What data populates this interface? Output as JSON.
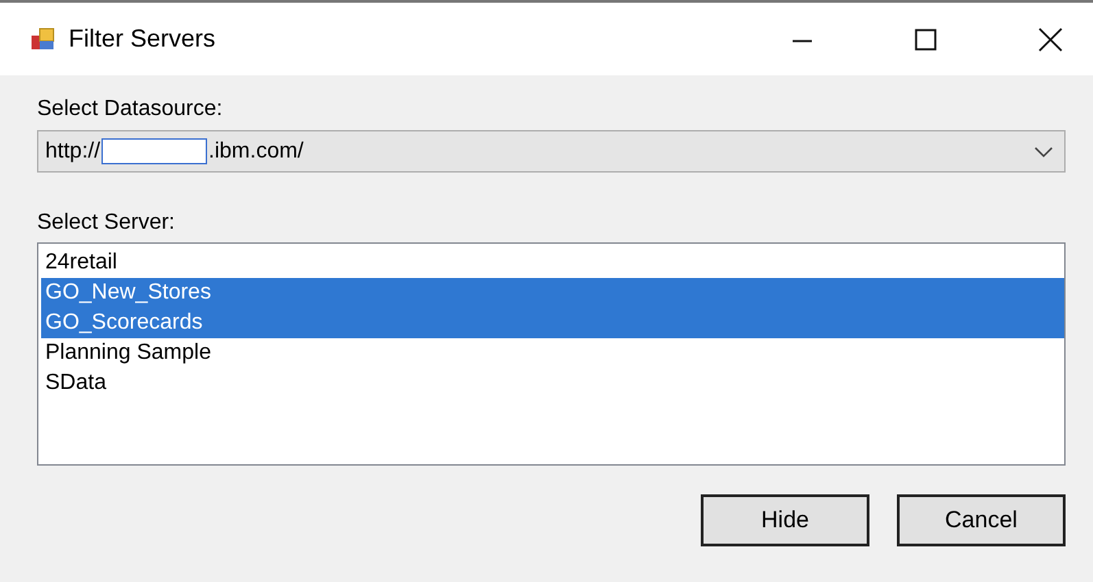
{
  "window": {
    "title": "Filter Servers"
  },
  "datasource": {
    "label": "Select Datasource:",
    "value_start": "http://",
    "value_end": ".ibm.com/",
    "redacted": true
  },
  "server_list": {
    "label": "Select Server:",
    "items": [
      {
        "label": "24retail",
        "selected": false
      },
      {
        "label": "GO_New_Stores",
        "selected": true
      },
      {
        "label": "GO_Scorecards",
        "selected": true
      },
      {
        "label": "Planning Sample",
        "selected": false
      },
      {
        "label": "SData",
        "selected": false
      }
    ]
  },
  "buttons": [
    {
      "label": "Hide"
    },
    {
      "label": "Cancel"
    }
  ]
}
